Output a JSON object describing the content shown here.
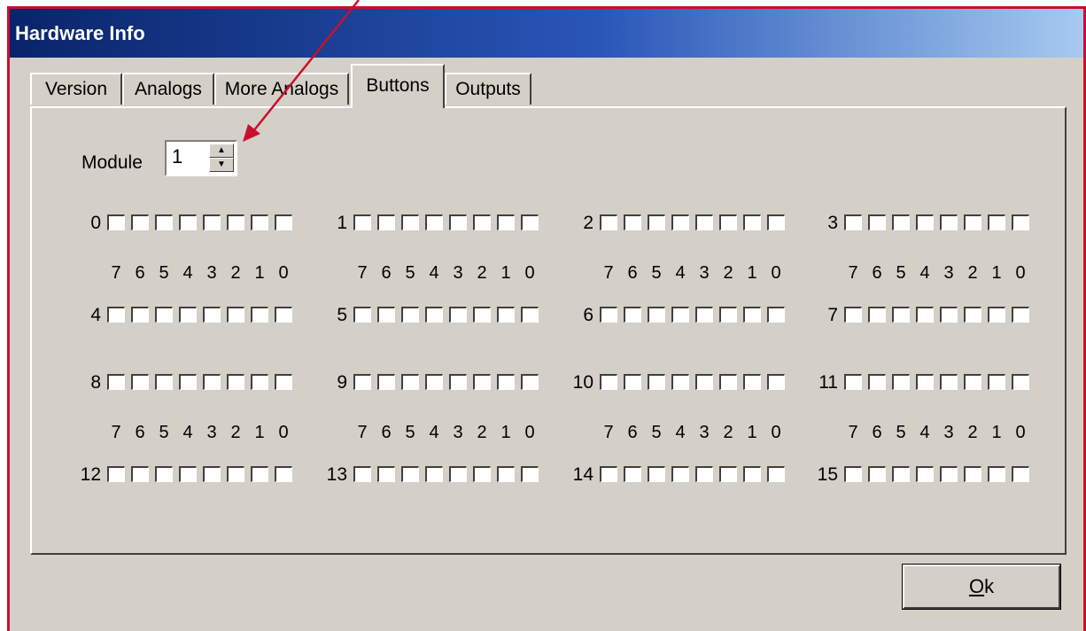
{
  "window": {
    "title": "Hardware Info"
  },
  "tabs": [
    {
      "label": "Version"
    },
    {
      "label": "Analogs"
    },
    {
      "label": "More Analogs"
    },
    {
      "label": "Buttons"
    },
    {
      "label": "Outputs"
    }
  ],
  "active_tab": "Buttons",
  "module": {
    "label": "Module",
    "value": "1"
  },
  "bit_labels": [
    "7",
    "6",
    "5",
    "4",
    "3",
    "2",
    "1",
    "0"
  ],
  "button_rows": [
    "0",
    "1",
    "2",
    "3",
    "4",
    "5",
    "6",
    "7",
    "8",
    "9",
    "10",
    "11",
    "12",
    "13",
    "14",
    "15"
  ],
  "ok_button": {
    "mnemonic": "O",
    "rest": "k"
  },
  "annotation": {
    "color": "#c8102e"
  }
}
